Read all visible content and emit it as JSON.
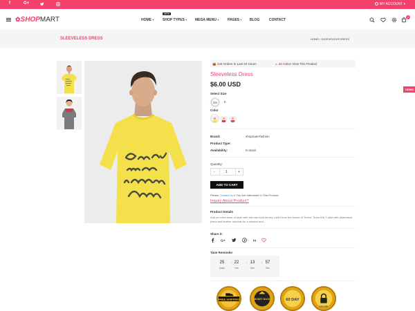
{
  "topbar": {
    "social": [
      "f",
      "G+",
      "twitter",
      "instagram"
    ],
    "account_label": "MY ACCOUNT",
    "account_chevron": "▾"
  },
  "header": {
    "logo_shop": "SHOP",
    "logo_mart": "MART",
    "nav": [
      {
        "label": "HOME",
        "chevron": "▾"
      },
      {
        "label": "SHOP TYPES",
        "chevron": "▾"
      },
      {
        "label": "MEGA MENU",
        "chevron": "▾"
      },
      {
        "label": "PAGES",
        "chevron": "▾"
      },
      {
        "label": "BLOG"
      },
      {
        "label": "CONTACT"
      }
    ],
    "new_badge": "NEW",
    "cart_count": "0"
  },
  "breadcrumb": {
    "page_title": "SLEEVELESS DRESS",
    "trail": "HOME  /  SLEEVELESS DRESS"
  },
  "product": {
    "orders_count": "134",
    "orders_text": "Orders In Last 24 Hours",
    "active_count": "42",
    "active_text": "Active View This Product",
    "title": "Sleeveless Dress",
    "price": "$6.00 USD",
    "select_size_label": "Select Size",
    "sizes": [
      "XS",
      "S"
    ],
    "color_label": "Color",
    "brand_label": "Brand:",
    "brand_value": "shopmart-fashion",
    "type_label": "Product Type:",
    "type_value": "",
    "availability_label": "Availability:",
    "availability_value": "In stock",
    "quantity_label": "Quantity:",
    "qty_minus": "-",
    "qty_value": "1",
    "qty_plus": "+",
    "add_to_cart": "ADD TO CART",
    "contact_prefix": "Please ",
    "contact_link": "Contact Us",
    "contact_suffix": " If You Are Interested In This Product.",
    "inquiry": "Inquiry About Product?",
    "details_label": "Product Details",
    "details_text": "Add an extra dose of style with this raw look henley t-shirt from the house of Tinted. Team this T-shirt with distressed jeans and leather sandals for a relaxed and...",
    "share_label": "Share it:",
    "share_icons": [
      "facebook",
      "google-plus",
      "twitter",
      "pinterest",
      "linkedin",
      "heart"
    ],
    "timer_label": "Time Reminder",
    "timer": [
      {
        "value": "25",
        "unit": "Days"
      },
      {
        "value": "22",
        "unit": "Hrs"
      },
      {
        "value": "13",
        "unit": "Min"
      },
      {
        "value": "57",
        "unit": "Sec"
      }
    ],
    "trust_badges": [
      "FREE SHIPPING",
      "MONEY BACK",
      "60 DAY",
      "SECURE"
    ],
    "tshirt_lines": [
      "Every",
      "morning",
      "is a small",
      "Victory"
    ]
  },
  "demo_tab": "DEMO",
  "colors": {
    "accent": "#f4416b",
    "tshirt": "#f3e04a",
    "gold": "#e0a516"
  }
}
